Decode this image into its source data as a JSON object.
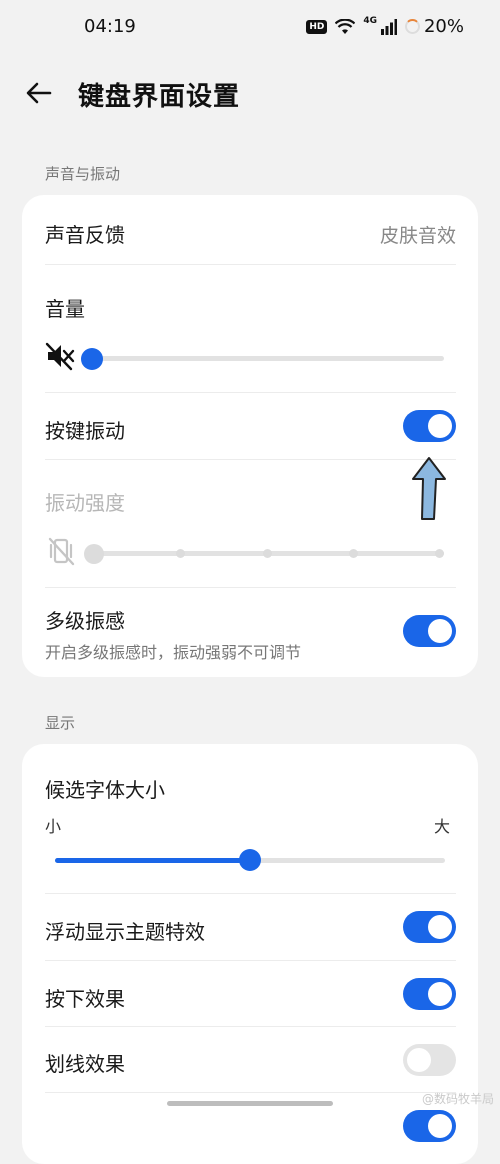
{
  "status_bar": {
    "time": "04:19",
    "hd": "HD",
    "network": "4G",
    "battery": "20%"
  },
  "header": {
    "title": "键盘界面设置"
  },
  "sections": [
    {
      "title": "声音与振动"
    },
    {
      "title": "显示"
    }
  ],
  "sound": {
    "feedback_label": "声音反馈",
    "feedback_value": "皮肤音效",
    "volume_label": "音量",
    "volume_level": 0,
    "key_vibration_label": "按键振动",
    "key_vibration_on": true,
    "vibration_strength_label": "振动强度",
    "vibration_strength_level": 0,
    "multi_vibration_label": "多级振感",
    "multi_vibration_desc": "开启多级振感时，振动强弱不可调节",
    "multi_vibration_on": true
  },
  "display": {
    "font_size_label": "候选字体大小",
    "font_min_label": "小",
    "font_max_label": "大",
    "font_size_level": 0.5,
    "floating_theme_label": "浮动显示主题特效",
    "floating_theme_on": true,
    "press_effect_label": "按下效果",
    "press_effect_on": true,
    "swipe_effect_label": "划线效果",
    "swipe_effect_on": false
  },
  "colors": {
    "accent": "#1a66e8",
    "background": "#f2f2f2",
    "card": "#ffffff"
  },
  "watermark": "@数码牧羊局"
}
